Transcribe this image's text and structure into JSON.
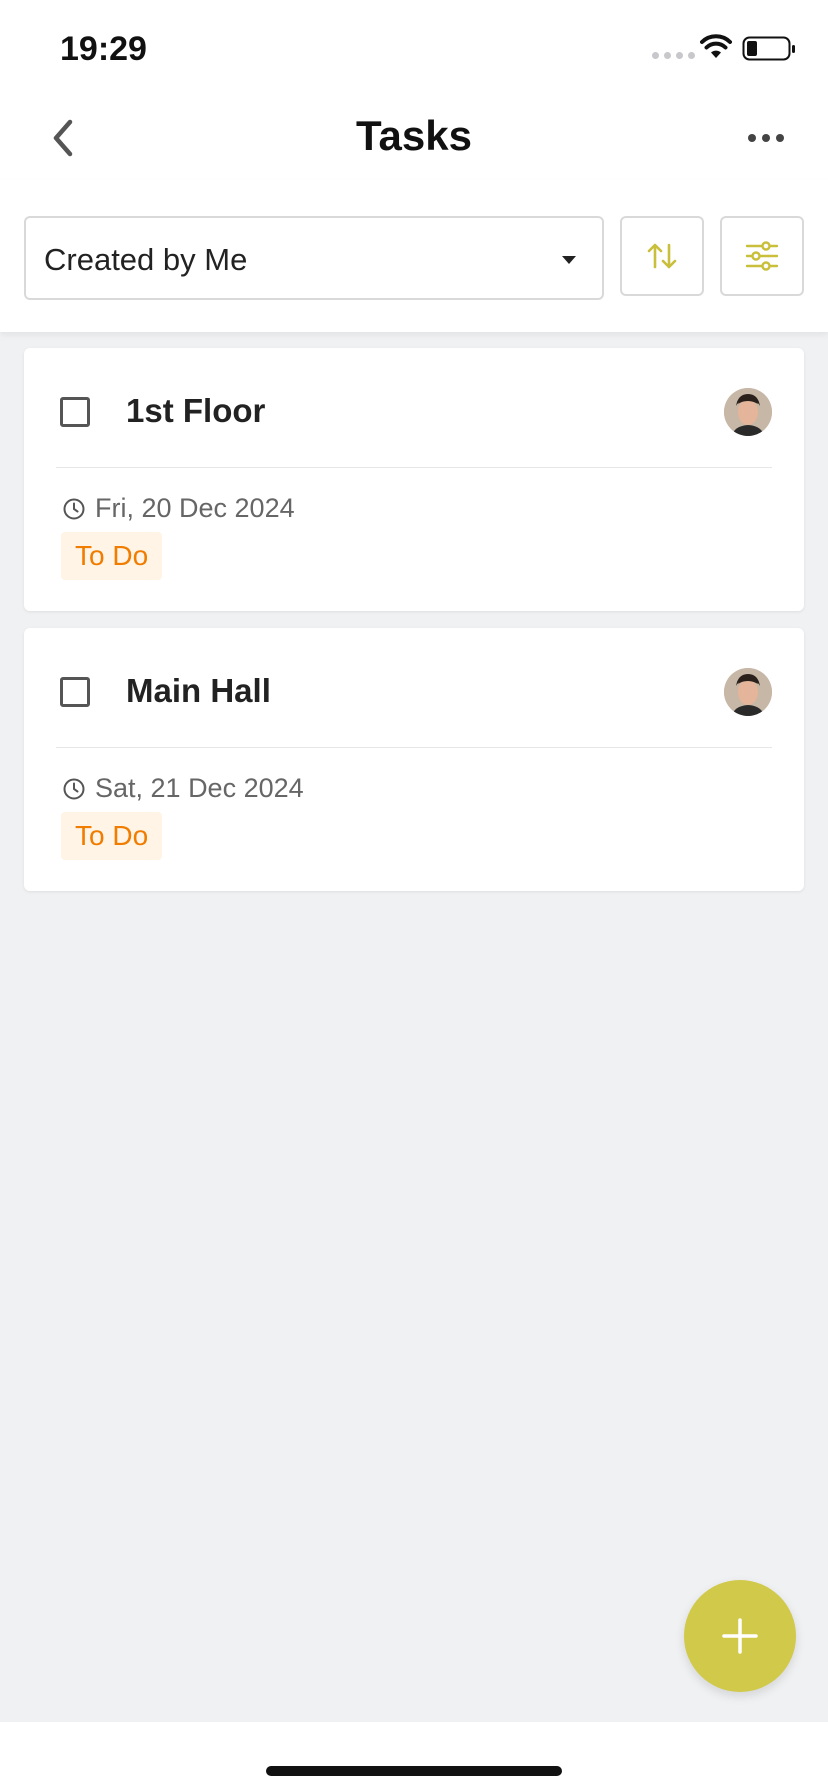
{
  "status_bar": {
    "time": "19:29"
  },
  "header": {
    "title": "Tasks"
  },
  "toolbar": {
    "filter_value": "Created by Me"
  },
  "tasks": [
    {
      "title": "1st Floor",
      "date": "Fri, 20 Dec 2024",
      "status": "To Do"
    },
    {
      "title": "Main Hall",
      "date": "Sat, 21 Dec 2024",
      "status": "To Do"
    }
  ],
  "colors": {
    "accent": "#d1c94a",
    "status_todo_text": "#f07c00",
    "status_todo_bg": "#fff4e6",
    "background": "#f0f1f3"
  },
  "icons": [
    "back-icon",
    "more-icon",
    "sort-icon",
    "filter-icon",
    "clock-icon",
    "plus-icon",
    "wifi-icon",
    "battery-icon",
    "signal-icon"
  ]
}
